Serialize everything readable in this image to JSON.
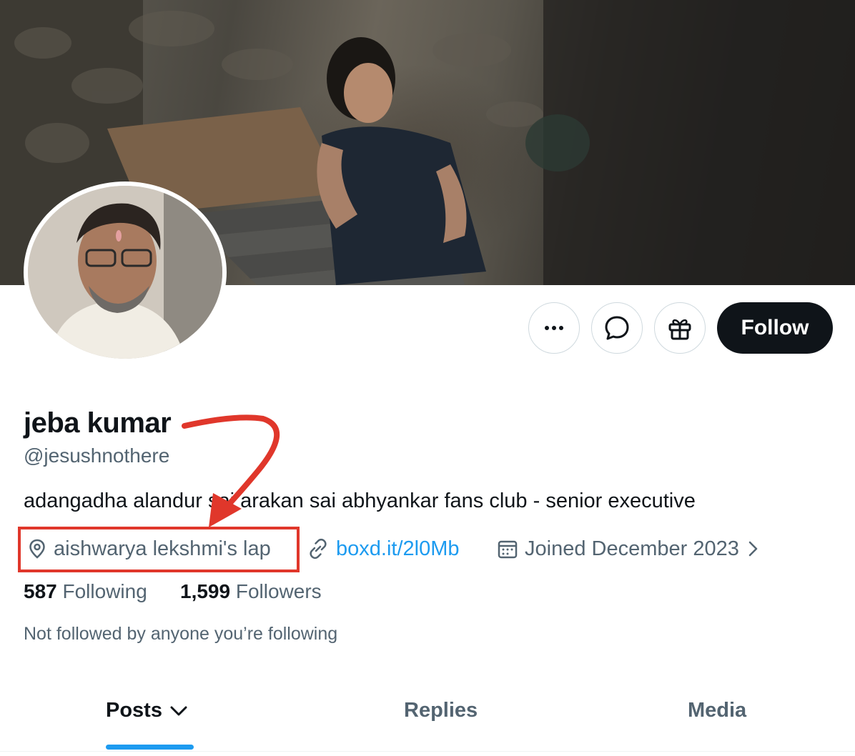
{
  "profile": {
    "display_name": "jeba kumar",
    "handle": "@jesushnothere",
    "bio": "adangadha alandur sai arakan sai abhyankar fans club - senior executive",
    "location": "aishwarya lekshmi's lap",
    "website": "boxd.it/2l0Mb",
    "joined": "Joined December 2023"
  },
  "stats": {
    "following_count": "587",
    "following_label": "Following",
    "followers_count": "1,599",
    "followers_label": "Followers"
  },
  "not_followed_text": "Not followed by anyone you’re following",
  "actions": {
    "more_icon": "more-horizontal-icon",
    "message_icon": "message-bubble-icon",
    "gift_icon": "gift-icon",
    "follow_label": "Follow"
  },
  "tabs": [
    {
      "label": "Posts",
      "active": true
    },
    {
      "label": "Replies",
      "active": false
    },
    {
      "label": "Media",
      "active": false
    }
  ],
  "colors": {
    "accent": "#1d9bf0",
    "annotation": "#e0372b",
    "text_primary": "#0f1419",
    "text_secondary": "#536471"
  }
}
